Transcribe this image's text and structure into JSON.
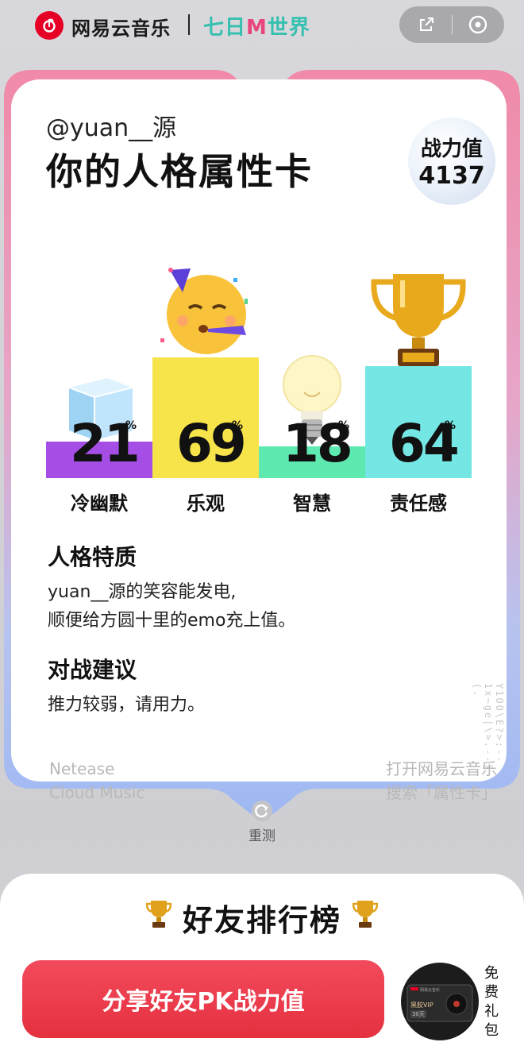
{
  "topbar": {
    "brand": "网易云音乐",
    "event_pre": "七日",
    "event_mid": "M",
    "event_post": "世界",
    "share_icon": "share-icon",
    "close_icon": "target-close-icon"
  },
  "card": {
    "handle": "@yuan__源",
    "title": "你的人格属性卡",
    "power_label": "战力值",
    "power_value": "4137"
  },
  "chart_data": {
    "type": "bar",
    "categories": [
      "冷幽默",
      "乐观",
      "智慧",
      "责任感"
    ],
    "values": [
      21,
      69,
      18,
      64
    ],
    "unit": "%",
    "colors": [
      "#a44ee6",
      "#f7e34a",
      "#5ee9b1",
      "#74e7e4"
    ],
    "icons": [
      "ice-cube-icon",
      "party-face-icon",
      "light-bulb-icon",
      "trophy-icon"
    ],
    "ylim": [
      0,
      100
    ]
  },
  "traits": {
    "title": "人格特质",
    "line1": "yuan__源的笑容能发电,",
    "line2": "顺便给方圆十里的emo充上值。"
  },
  "battle": {
    "title": "对战建议",
    "line1": "推力较弱，请用力。"
  },
  "footer": {
    "left1": "Netease",
    "left2": "Cloud Music",
    "right1": "打开网易云音乐",
    "right2": "搜索「属性卡」"
  },
  "retest": {
    "label": "重测"
  },
  "ranking": {
    "title": "好友排行榜"
  },
  "share": {
    "label": "分享好友PK战力值"
  },
  "gift": {
    "label": "免费礼包",
    "card_line1": "网易云音乐",
    "card_line2": "黑胶VIP",
    "card_line3": "30天"
  }
}
